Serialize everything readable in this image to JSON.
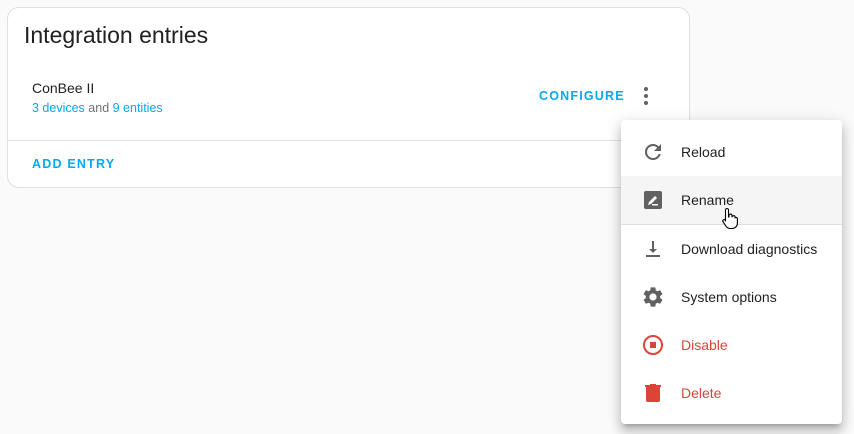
{
  "card": {
    "title": "Integration entries",
    "entry": {
      "name": "ConBee II",
      "devices_link": "3 devices",
      "and_text": " and ",
      "entities_link": "9 entities",
      "configure_label": "CONFIGURE"
    },
    "add_entry_label": "ADD ENTRY"
  },
  "menu": {
    "items": [
      {
        "label": "Reload",
        "icon": "reload-icon"
      },
      {
        "label": "Rename",
        "icon": "rename-icon"
      },
      {
        "label": "Download diagnostics",
        "icon": "download-icon"
      },
      {
        "label": "System options",
        "icon": "gear-icon"
      },
      {
        "label": "Disable",
        "icon": "stop-circle-icon"
      },
      {
        "label": "Delete",
        "icon": "trash-icon"
      }
    ]
  },
  "colors": {
    "accent": "#03a9f4",
    "danger": "#db4437",
    "icon": "#616161"
  }
}
